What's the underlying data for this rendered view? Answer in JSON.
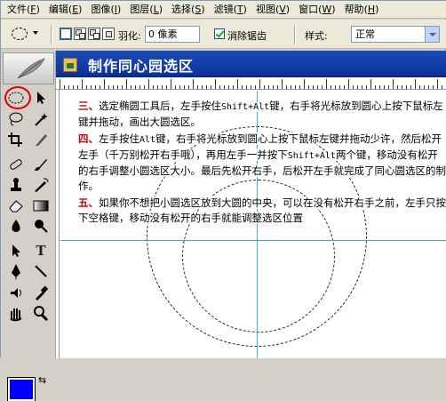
{
  "menu": [
    {
      "label": "文件",
      "key": "F"
    },
    {
      "label": "编辑",
      "key": "E"
    },
    {
      "label": "图像",
      "key": "I"
    },
    {
      "label": "图层",
      "key": "L"
    },
    {
      "label": "选择",
      "key": "S"
    },
    {
      "label": "滤镜",
      "key": "T"
    },
    {
      "label": "视图",
      "key": "V"
    },
    {
      "label": "窗口",
      "key": "W"
    },
    {
      "label": "帮助",
      "key": "H"
    }
  ],
  "options": {
    "feather_label": "羽化:",
    "feather_value": "0 像素",
    "antialias_label": "消除锯齿",
    "antialias_checked": true,
    "style_label": "样式:",
    "style_value": "正常"
  },
  "slide": {
    "title": "制作同心园选区",
    "steps": [
      {
        "num": "三、",
        "parts": [
          {
            "t": "选定椭圆工具后，左手按住",
            "mono": false
          },
          {
            "t": "Shift+Alt",
            "mono": true
          },
          {
            "t": "键，右手将光标放到圆心上按下鼠标左键并拖动，画出大圆选区。",
            "mono": false
          }
        ]
      },
      {
        "num": "四、",
        "parts": [
          {
            "t": "左手按住",
            "mono": false
          },
          {
            "t": "Alt",
            "mono": true
          },
          {
            "t": "键，右手将光标放到圆心上按下鼠标左键并拖动少许，然后松开左手（千万别松开右手哦），再用左手一并按下",
            "mono": false
          },
          {
            "t": "Shift+Alt",
            "mono": true
          },
          {
            "t": "两个键，移动没有松开的右手调整小圆选区大小。最后先松开右手，后松开左手就完成了同心圆选区的制作。",
            "mono": false
          }
        ]
      },
      {
        "num": "五、",
        "parts": [
          {
            "t": "如果你不想把小圆选区放到大圆的中央，可以在没有松开右手之前，左手只按下空格键，移动没有松开的右手就能调整选区位置",
            "mono": false
          }
        ]
      }
    ]
  },
  "toolbox": {
    "foreground_color": "#0000ff",
    "selected_tool": "elliptical-marquee"
  },
  "colors": {
    "title_bar": "#1d4db8",
    "step_number": "#cc0000",
    "guide": "#3aa8d8"
  }
}
